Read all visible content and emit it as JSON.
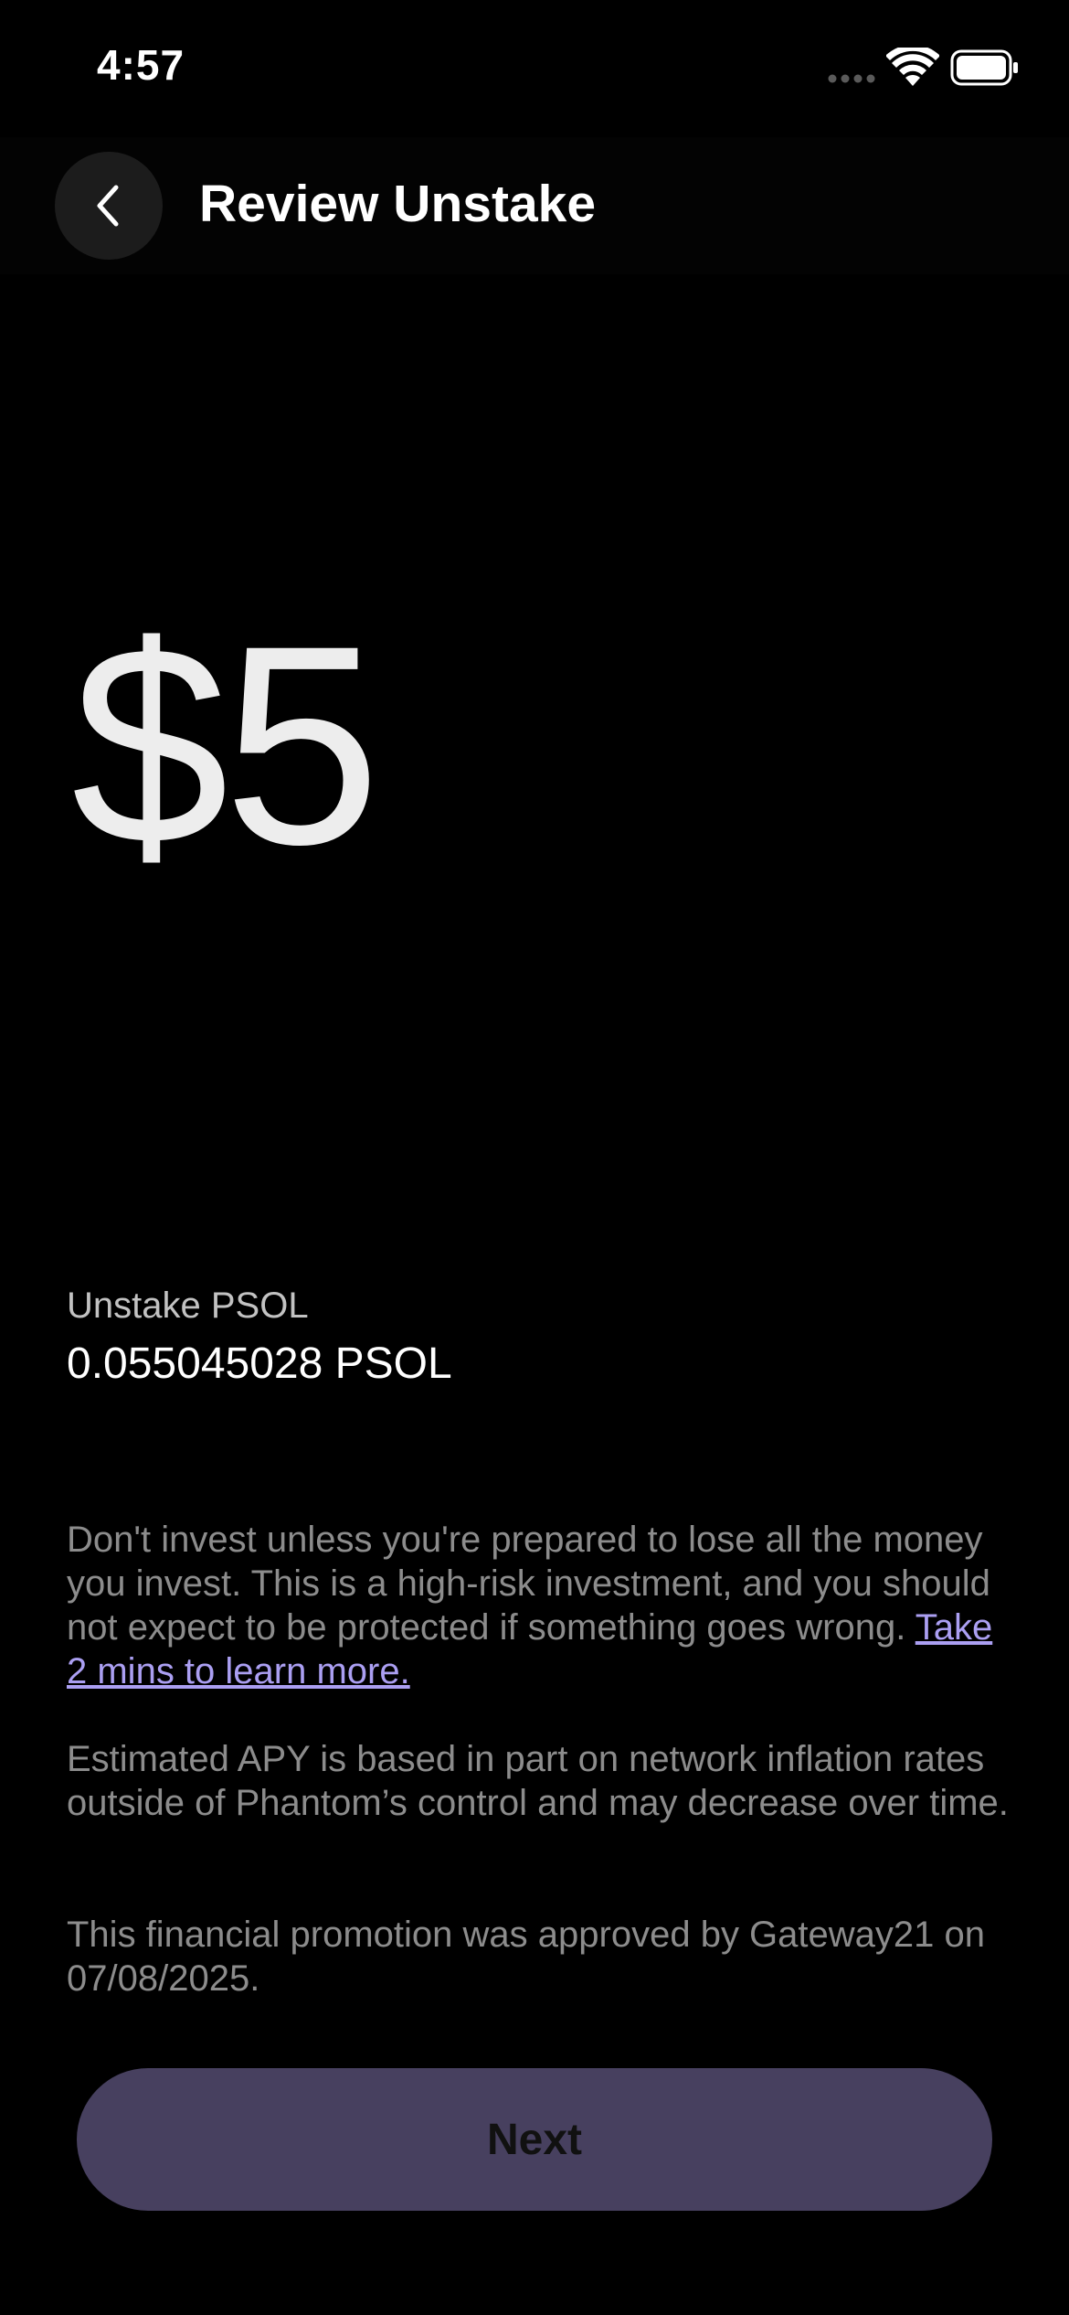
{
  "status_bar": {
    "time": "4:57"
  },
  "header": {
    "title": "Review Unstake",
    "back_icon": "chevron-left-icon"
  },
  "amount": {
    "display": "$5"
  },
  "unstake": {
    "label": "Unstake PSOL",
    "value": "0.055045028 PSOL"
  },
  "disclaimers": {
    "risk_text": "Don't invest unless you're prepared to lose all the money you invest. This is a high-risk investment, and you should not expect to be protected if something goes wrong.",
    "risk_link": "Take 2 mins to learn more.",
    "apy_text": "Estimated APY is based in part on network inflation rates outside of Phantom’s control and may decrease over time.",
    "approval_text": "This financial promotion was approved by Gateway21 on 07/08/2025."
  },
  "actions": {
    "next_label": "Next"
  },
  "colors": {
    "background": "#000000",
    "link": "#ab9ff2",
    "button": "#47405f",
    "muted_text": "#8c8c8c"
  }
}
